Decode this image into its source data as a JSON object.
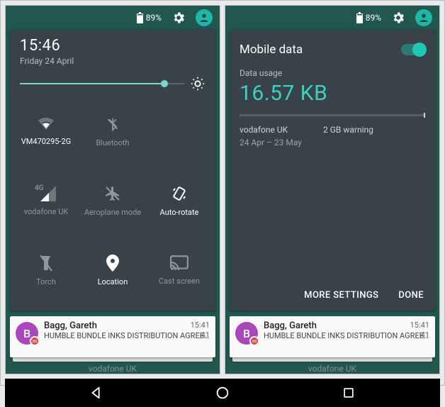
{
  "status": {
    "battery_pct": "89%"
  },
  "left": {
    "time": "15:46",
    "date": "Friday 24 April",
    "tiles": {
      "wifi": "VM470295-2G",
      "bluetooth": "Bluetooth",
      "cell": "vodafone UK",
      "cell_badge": "4G",
      "airplane": "Aeroplane mode",
      "rotate": "Auto-rotate",
      "torch": "Torch",
      "location": "Location",
      "cast": "Cast screen"
    }
  },
  "right": {
    "title": "Mobile data",
    "usage_label": "Data usage",
    "usage_value": "16.57 KB",
    "carrier": "vodafone UK",
    "period": "24 Apr – 23 May",
    "warning": "2 GB warning",
    "more": "MORE SETTINGS",
    "done": "DONE"
  },
  "notif": {
    "initial": "B",
    "title": "Bagg, Gareth",
    "subject": "HUMBLE BUNDLE INKS DISTRIBUTION AGREEME…",
    "ts": "15:41",
    "count": "41"
  },
  "footer_carrier": "vodafone UK"
}
